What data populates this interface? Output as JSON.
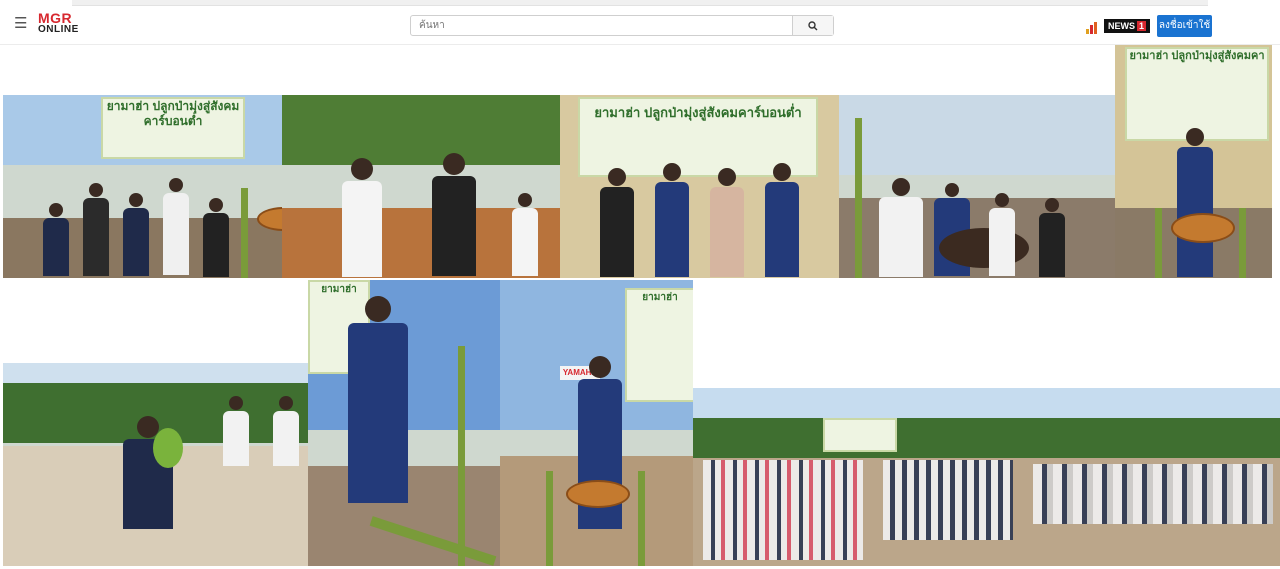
{
  "header": {
    "logo_top": "MGR",
    "logo_bottom": "ONLINE",
    "search_placeholder": "ค้นหา",
    "news_badge": "NEWS",
    "news_channel": "1",
    "login_label": "ลงชื่อเข้าใช้"
  },
  "icons": {
    "menu": "hamburger-icon",
    "search": "search-icon",
    "chart": "bar-chart-icon"
  },
  "colors": {
    "brand_red": "#d7282f",
    "login_blue": "#1a73d1",
    "banner_green": "#2f6e2b"
  },
  "gallery": {
    "banner_text_a": "ยามาฮ่า ปลูกป่ามุ่งสู่สังคมคาร์บอนต่ำ",
    "banner_text_b": "ยามาฮ่า ปลูกป่ามุ่งสู่สังคมคา",
    "banner_text_c": "ยามาฮ่า ปลูกป่ามุ่งสู่สังคมคาร์บอนต่ำ",
    "banner_text_d": "ยามาฮ่า",
    "banner_text_e": "ยามาฮ่า",
    "sign_text_side": "YAMAHA"
  }
}
